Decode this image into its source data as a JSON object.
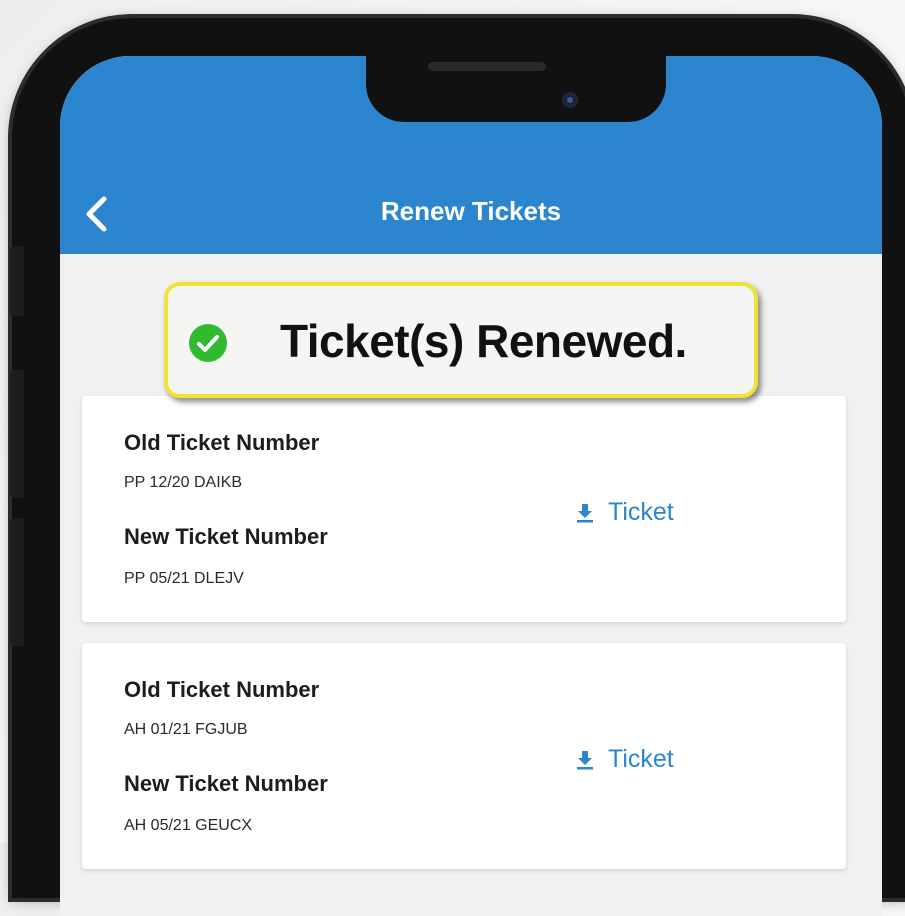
{
  "header": {
    "title": "Renew Tickets",
    "back_icon": "chevron-left-icon"
  },
  "toast": {
    "message": "Ticket(s) Renewed.",
    "icon": "check-circle-icon",
    "icon_color": "#2fba2f",
    "border_color": "#f0e23a"
  },
  "tickets": [
    {
      "old_label": "Old Ticket Number",
      "old_value": "PP 12/20 DAIKB",
      "new_label": "New Ticket Number",
      "new_value": "PP 05/21 DLEJV",
      "download_label": "Ticket",
      "download_icon": "download-icon"
    },
    {
      "old_label": "Old Ticket Number",
      "old_value": "AH 01/21 FGJUB",
      "new_label": "New Ticket Number",
      "new_value": "AH 05/21 GEUCX",
      "download_label": "Ticket",
      "download_icon": "download-icon"
    }
  ],
  "colors": {
    "header_bg": "#2b86cf",
    "accent": "#2b86cf",
    "screen_bg": "#f1f1f1"
  }
}
